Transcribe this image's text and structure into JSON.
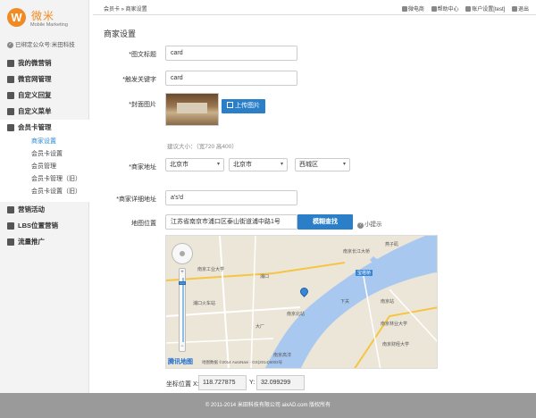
{
  "brand": {
    "logo_letter": "W",
    "name_cn": "微米",
    "name_en": "Mobile Marketing"
  },
  "account": {
    "bound_text": "已绑定公众号:米田科技"
  },
  "sidebar": {
    "items": [
      {
        "label": "我的微营销"
      },
      {
        "label": "微官网管理"
      },
      {
        "label": "自定义回复"
      },
      {
        "label": "自定义菜单"
      },
      {
        "label": "会员卡管理"
      }
    ],
    "submenu": [
      {
        "label": "商家设置"
      },
      {
        "label": "会员卡设置"
      },
      {
        "label": "会员管理"
      },
      {
        "label": "会员卡管理（旧）"
      },
      {
        "label": "会员卡设置（旧）"
      }
    ],
    "items_after": [
      {
        "label": "营销活动"
      },
      {
        "label": "LBS位置营销"
      },
      {
        "label": "流量推广"
      }
    ]
  },
  "breadcrumb": "会员卡 » 商家设置",
  "toplinks": {
    "shop": "微电商",
    "help": "帮助中心",
    "account": "账户设置[test]",
    "logout": "退出"
  },
  "page_title": "商家设置",
  "form": {
    "title_label": "*图文标题",
    "title_value": "card",
    "keyword_label": "*触发关键字",
    "keyword_value": "card",
    "cover_label": "*封面图片",
    "upload_label": "上传图片",
    "size_hint": "建议大小：（宽720 高400）",
    "address_label": "*商家地址",
    "province": "北京市",
    "city": "北京市",
    "district": "西城区",
    "detail_label": "*商家详细地址",
    "detail_value": "a's'd",
    "map_label": "地图位置",
    "map_address": "江苏省南京市浦口区泰山街道浦中路1号",
    "search_button": "模糊查找",
    "tip": "小提示",
    "coord_label": "坐标位置 X:",
    "coord_x": "118.727875",
    "coord_y_label": "Y:",
    "coord_y": "32.099299"
  },
  "map": {
    "labels": {
      "l1": "南京长江大桥",
      "l2": "燕子矶",
      "l3": "宝塔桥",
      "l4": "浦口",
      "l5": "南京北站",
      "l6": "下关",
      "l7": "南京站",
      "l8": "南京林业大学",
      "l9": "南京财经大学",
      "l10": "大厂",
      "l11": "浦口火车站",
      "l12": "南京工业大学",
      "l13": "南京高淳"
    },
    "logo": "腾讯地图",
    "copyright": "地图数据 ©2014 AutoNavi - GS(2014)6002号",
    "water_color": "#a9c8ef",
    "land_color": "#ece6d9",
    "road_color": "#f5c542"
  },
  "footer": "© 2011-2014 米田科技有限公司 aixAD.com 版权所有"
}
